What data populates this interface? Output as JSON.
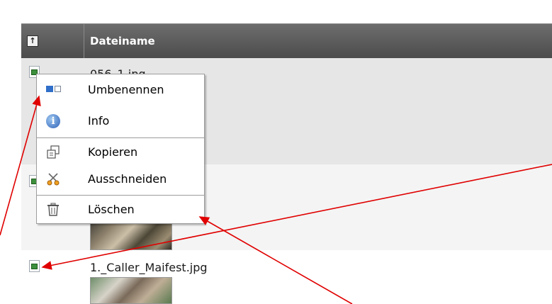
{
  "table": {
    "sort_symbol": "↑",
    "column_title": "Dateiname"
  },
  "files": [
    {
      "name": "056_1.jpg",
      "icon": "image-file-icon"
    },
    {
      "name": "",
      "icon": "image-file-icon"
    },
    {
      "name": "1._Caller_Maifest.jpg",
      "icon": "image-file-icon"
    }
  ],
  "context_menu": {
    "items": [
      {
        "label": "Umbenennen",
        "icon": "rename-icon"
      },
      {
        "label": "Info",
        "icon": "info-icon"
      },
      {
        "label": "Kopieren",
        "icon": "copy-icon"
      },
      {
        "label": "Ausschneiden",
        "icon": "scissors-icon"
      },
      {
        "label": "Löschen",
        "icon": "trash-icon"
      }
    ]
  },
  "colors": {
    "header_bg": "#5a5a5a",
    "row_alt": "#e6e6e6",
    "annotation_arrow": "#e00000",
    "info_blue": "#2f62b8"
  }
}
